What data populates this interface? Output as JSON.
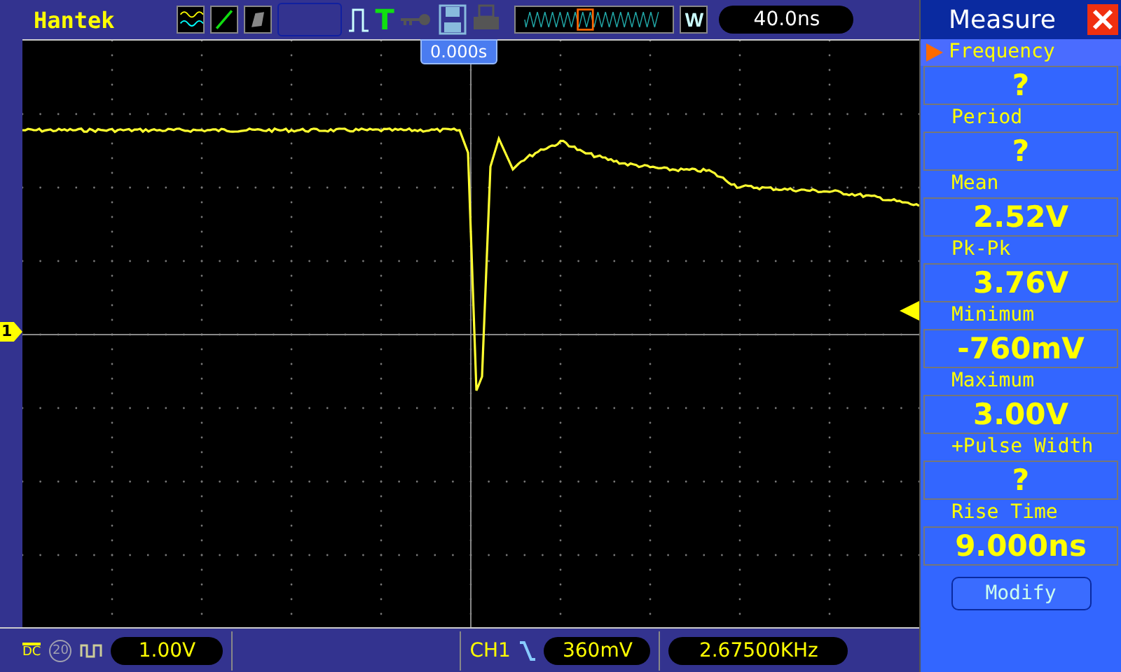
{
  "top_bar": {
    "brand": "Hantek",
    "trigger_type_label": "T",
    "trigger_position": "0.000s",
    "wave_button": "W",
    "timebase": "40.0ns"
  },
  "screen": {
    "channel_marker": "1"
  },
  "measure_panel": {
    "title": "Measure",
    "items": [
      {
        "label": "Frequency",
        "value": "?",
        "selected": true
      },
      {
        "label": "Period",
        "value": "?",
        "selected": false
      },
      {
        "label": "Mean",
        "value": "2.52V",
        "selected": false
      },
      {
        "label": "Pk-Pk",
        "value": "3.76V",
        "selected": false
      },
      {
        "label": "Minimum",
        "value": "-760mV",
        "selected": false
      },
      {
        "label": "Maximum",
        "value": "3.00V",
        "selected": false
      },
      {
        "label": "+Pulse Width",
        "value": "?",
        "selected": false
      },
      {
        "label": "Rise Time",
        "value": "9.000ns",
        "selected": false
      }
    ],
    "modify_button": "Modify"
  },
  "status_bar": {
    "coupling": "DC",
    "bandwidth_limit": {
      "label": "20",
      "on": false
    },
    "volts_per_div": "1.00V",
    "trigger_source": "CH1",
    "trigger_level": "360mV",
    "frequency": "2.67500KHz"
  }
}
